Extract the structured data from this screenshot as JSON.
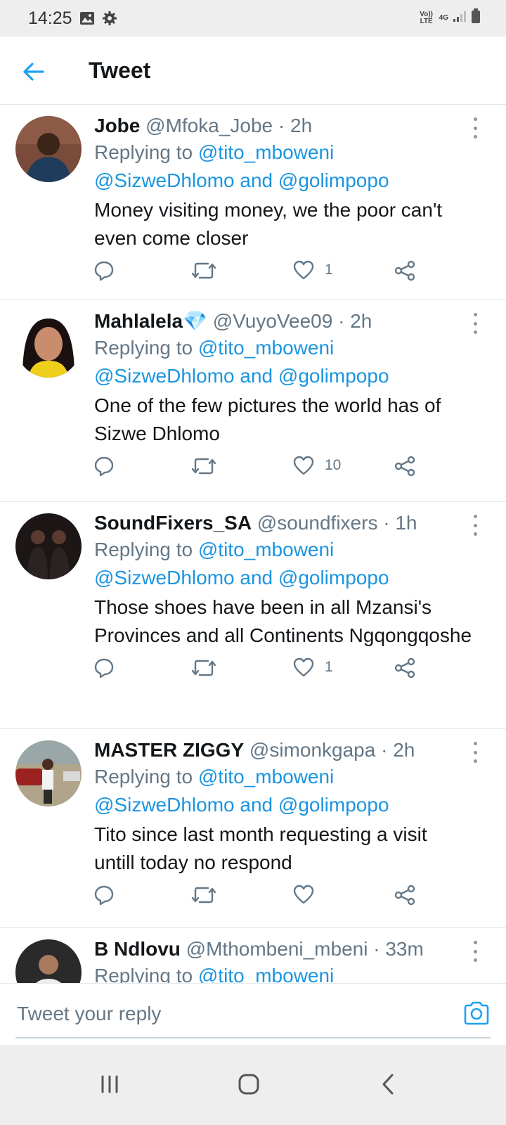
{
  "status_bar": {
    "time": "14:25",
    "volte": "Vo)) LTE",
    "network": "4G"
  },
  "header": {
    "title": "Tweet"
  },
  "tweets": [
    {
      "name": "Jobe",
      "handle": "@Mfoka_Jobe",
      "age": "2h",
      "replying_prefix": "Replying to",
      "mention1": "@tito_mboweni",
      "mention2": "@SizweDhlomo",
      "and": "and",
      "mention3": "@golimpopo",
      "text": "Money visiting money, we the poor can't even come closer",
      "likes": "1",
      "avatar_color": "#7a4a3a"
    },
    {
      "name": "Mahlalela💎",
      "handle": "@VuyoVee09",
      "age": "2h",
      "replying_prefix": "Replying to",
      "mention1": "@tito_mboweni",
      "mention2": "@SizweDhlomo",
      "and": "and",
      "mention3": "@golimpopo",
      "text": "One of the few pictures the world has of Sizwe Dhlomo",
      "likes": "10",
      "avatar_color": "#3a2a24"
    },
    {
      "name": "SoundFixers_SA",
      "handle": "@soundfixers",
      "age": "1h",
      "replying_prefix": "Replying to",
      "mention1": "@tito_mboweni",
      "mention2": "@SizweDhlomo",
      "and": "and",
      "mention3": "@golimpopo",
      "text": "Those shoes have been in all Mzansi's Provinces and all Continents Ngqongqoshe",
      "likes": "1",
      "avatar_color": "#1c1616"
    },
    {
      "name": "MASTER ZIGGY",
      "handle": "@simonkgapa",
      "age": "2h",
      "replying_prefix": "Replying to",
      "mention1": "@tito_mboweni",
      "mention2": "@SizweDhlomo",
      "and": "and",
      "mention3": "@golimpopo",
      "text": "Tito since last month requesting a visit untill today no respond",
      "likes": "",
      "avatar_color": "#8b5a48"
    },
    {
      "name": "B Ndlovu",
      "handle": "@Mthombeni_mbeni",
      "age": "33m",
      "replying_prefix": "Replying to",
      "mention1": "@tito_mboweni",
      "avatar_color": "#2a2a2a"
    }
  ],
  "compose": {
    "placeholder": "Tweet your reply"
  },
  "colors": {
    "accent": "#1da1f2",
    "mention": "#1b95e0",
    "secondary_text": "#657786",
    "divider": "#e1e8ed"
  }
}
